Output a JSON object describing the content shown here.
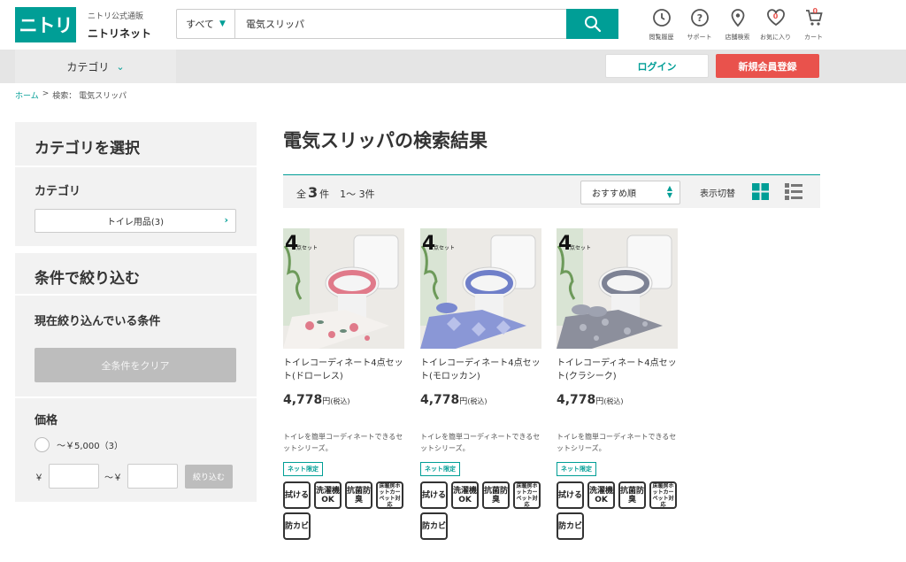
{
  "header": {
    "logo_text": "ニトリ",
    "brand_sub": "ニトリ公式通販",
    "brand_main": "ニトリネット",
    "search_category": "すべて",
    "search_value": "電気スリッパ",
    "icons": [
      {
        "label": "閲覧履歴",
        "icon": "history-icon"
      },
      {
        "label": "サポート",
        "icon": "help-icon"
      },
      {
        "label": "店舗検索",
        "icon": "location-icon"
      },
      {
        "label": "お気に入り",
        "icon": "heart-icon",
        "count": "0"
      },
      {
        "label": "カート",
        "icon": "cart-icon",
        "count": "0"
      }
    ]
  },
  "nav": {
    "category_label": "カテゴリ",
    "login_label": "ログイン",
    "register_label": "新規会員登録"
  },
  "breadcrumb": {
    "home": "ホーム",
    "separator": ">",
    "current": "検索： 電気スリッパ"
  },
  "sidebar": {
    "category_title": "カテゴリを選択",
    "category_sub": "カテゴリ",
    "category_option": "トイレ用品(3)",
    "filter_title": "条件で絞り込む",
    "current_filters": "現在絞り込んでいる条件",
    "clear_all": "全条件をクリア",
    "price_title": "価格",
    "price_option": "～￥5,000（3）",
    "yen": "￥",
    "tilde_yen": "～￥",
    "narrow_button": "絞り込む"
  },
  "results": {
    "title": "電気スリッパの検索結果",
    "total_prefix": "全",
    "total_count": "3",
    "total_suffix": "件",
    "range": "1～ 3件",
    "sort_value": "おすすめ順",
    "view_toggle_label": "表示切替"
  },
  "products": [
    {
      "name": "トイレコーディネート4点セット(ドローレス)",
      "price": "4,778",
      "yen": "円",
      "tax": "(税込)",
      "desc": "トイレを簡単コーディネートできるセットシリーズ。",
      "net_only": "ネット限定",
      "pattern_color": "#e07a8a"
    },
    {
      "name": "トイレコーディネート4点セット(モロッカン)",
      "price": "4,778",
      "yen": "円",
      "tax": "(税込)",
      "desc": "トイレを簡単コーディネートできるセットシリーズ。",
      "net_only": "ネット限定",
      "pattern_color": "#6f7fc9"
    },
    {
      "name": "トイレコーディネート4点セット(クラシーク)",
      "price": "4,778",
      "yen": "円",
      "tax": "(税込)",
      "desc": "トイレを簡単コーディネートできるセットシリーズ。",
      "net_only": "ネット限定",
      "pattern_color": "#7d8294"
    }
  ],
  "badges": [
    "拭ける",
    "洗濯機OK",
    "抗菌防臭",
    "床暖房ホットカーペット対応",
    "防カビ"
  ],
  "image_overlay": {
    "number": "4",
    "text": "点セット"
  },
  "colors": {
    "brand": "#009e96",
    "register": "#e9524c"
  }
}
